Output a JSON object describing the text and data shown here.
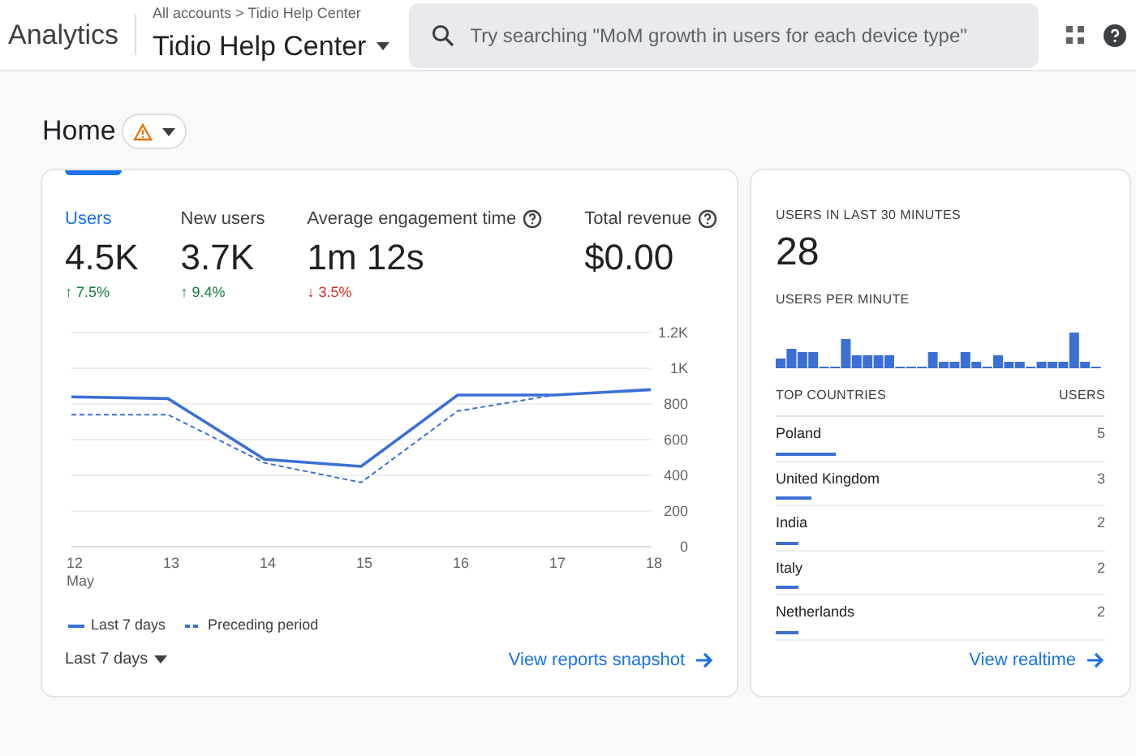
{
  "header": {
    "product": "Analytics",
    "breadcrumb": "All accounts > Tidio Help Center",
    "property": "Tidio Help Center",
    "search": {
      "placeholder": "Try searching \"MoM growth in users for each device type\""
    }
  },
  "page": {
    "title": "Home"
  },
  "metrics": [
    {
      "label": "Users",
      "value": "4.5K",
      "arrow": "↑",
      "change": "7.5%",
      "color": "#188038",
      "selected": true,
      "help": false
    },
    {
      "label": "New users",
      "value": "3.7K",
      "arrow": "↑",
      "change": "9.4%",
      "color": "#188038",
      "selected": false,
      "help": false
    },
    {
      "label": "Average engagement time",
      "value": "1m 12s",
      "arrow": "↓",
      "change": "3.5%",
      "color": "#d93025",
      "selected": false,
      "help": true
    },
    {
      "label": "Total revenue",
      "value": "$0.00",
      "selected": false,
      "help": true
    }
  ],
  "chart_data": {
    "type": "line",
    "categories": [
      "12\nMay",
      "13",
      "14",
      "15",
      "16",
      "17",
      "18"
    ],
    "ylim": [
      0,
      1200
    ],
    "yticks": [
      0,
      200,
      400,
      600,
      800,
      {
        "value": 1000,
        "label": "1K"
      },
      {
        "value": 1200,
        "label": "1.2K"
      }
    ],
    "grid": true,
    "legend": true,
    "series": [
      {
        "name": "Last 7 days",
        "color": "#3b6fd4",
        "line_style": "solid",
        "values": [
          840,
          830,
          490,
          450,
          850,
          850,
          880
        ]
      },
      {
        "name": "Preceding period",
        "color": "#3b6fd4",
        "line_style": "dashed",
        "values": [
          740,
          740,
          470,
          360,
          760,
          850,
          880
        ]
      }
    ]
  },
  "date_range": "Last 7 days",
  "reports_link": "View reports snapshot",
  "realtime": {
    "title": "USERS IN LAST 30 MINUTES",
    "count": "28",
    "per_minute_title": "USERS PER MINUTE",
    "countries_header": "TOP COUNTRIES",
    "users_header": "USERS",
    "countries": [
      {
        "name": "Poland",
        "users": "5",
        "level": 0.18
      },
      {
        "name": "United Kingdom",
        "users": "3",
        "level": 0.11
      },
      {
        "name": "India",
        "users": "2",
        "level": 0.07
      },
      {
        "name": "Italy",
        "users": "2",
        "level": 0.07
      },
      {
        "name": "Netherlands",
        "users": "2",
        "level": 0.07
      }
    ],
    "link": "View realtime"
  }
}
